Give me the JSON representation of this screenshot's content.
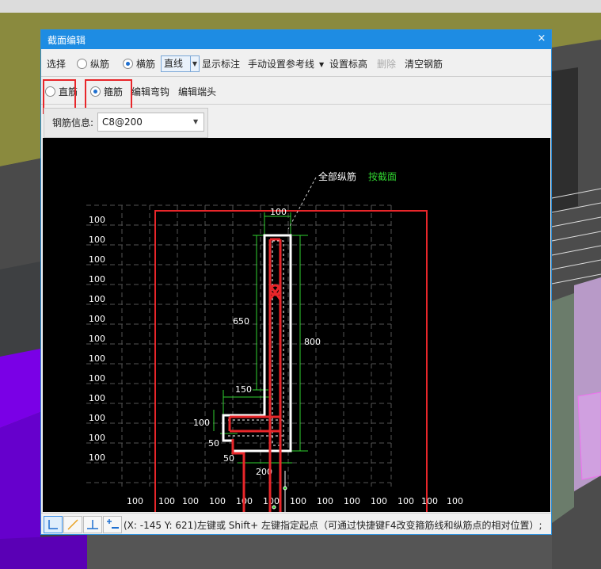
{
  "dialog": {
    "title": "截面编辑",
    "close_glyph": "×"
  },
  "toolbar1": {
    "select": "选择",
    "longitudinal": "纵筋",
    "transverse": "横筋",
    "line_type": "直线",
    "show_dims": "显示标注",
    "manual_ref": "手动设置参考线",
    "set_elev": "设置标高",
    "delete": "删除",
    "clear": "清空钢筋"
  },
  "toolbar2": {
    "straight": "直筋",
    "stirrup": "箍筋",
    "edit_hook": "编辑弯钩",
    "edit_end": "编辑端头"
  },
  "rebar_info": {
    "label": "钢筋信息:",
    "value": "C8@200"
  },
  "drawing": {
    "all_long_label": "全部纵筋",
    "section_label": "按截面",
    "grid_labels_left": [
      "100",
      "100",
      "100",
      "100",
      "100",
      "100",
      "100",
      "100",
      "100",
      "100",
      "100",
      "100",
      "100"
    ],
    "grid_labels_bottom": [
      "100",
      "100",
      "100",
      "100",
      "100",
      "100",
      "100",
      "100",
      "100",
      "100",
      "100",
      "100",
      "100"
    ],
    "dim_top": "100",
    "dim_650": "650",
    "dim_800": "800",
    "dim_150": "150",
    "dim_100": "100",
    "dim_50a": "50",
    "dim_50b": "50",
    "dim_200": "200",
    "colors": {
      "stirrup": "#e8262a",
      "dim": "#2fd12f",
      "grid": "#555555",
      "concrete": "#ffffff"
    }
  },
  "statusbar": {
    "message": "(X: -145 Y: 621)左键或 Shift+ 左键指定起点（可通过快捷键F4改变箍筋线和纵筋点的相对位置）;"
  }
}
